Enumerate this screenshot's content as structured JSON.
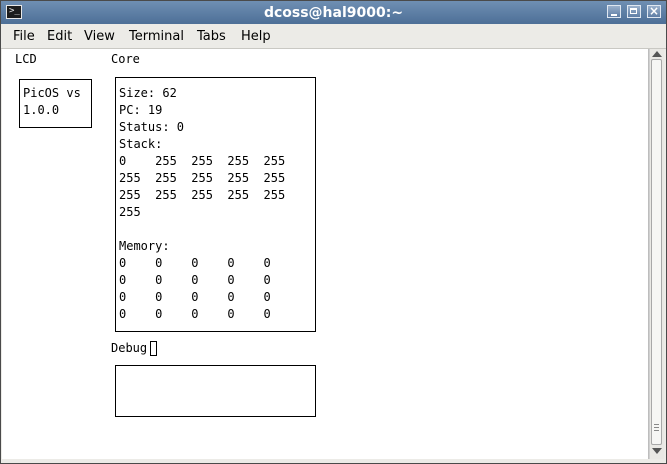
{
  "window": {
    "title": "dcoss@hal9000:~",
    "icon_text": ">_"
  },
  "menu": {
    "items": [
      "File",
      "Edit",
      "View",
      "Terminal",
      "Tabs",
      "Help"
    ]
  },
  "terminal": {
    "lcd_label": "LCD",
    "core_label": "Core",
    "lcd_lines": [
      "PicOS vs",
      "1.0.0"
    ],
    "core": {
      "size": "Size: 62",
      "pc": "PC: 19",
      "status": "Status: 0",
      "stack_label": "Stack:",
      "stack_rows": [
        "0    255  255  255  255",
        "255  255  255  255  255",
        "255  255  255  255  255",
        "255"
      ],
      "memory_label": "Memory:",
      "memory_rows": [
        "0    0    0    0    0",
        "0    0    0    0    0",
        "0    0    0    0    0",
        "0    0    0    0    0"
      ]
    },
    "debug_label": "Debug"
  }
}
